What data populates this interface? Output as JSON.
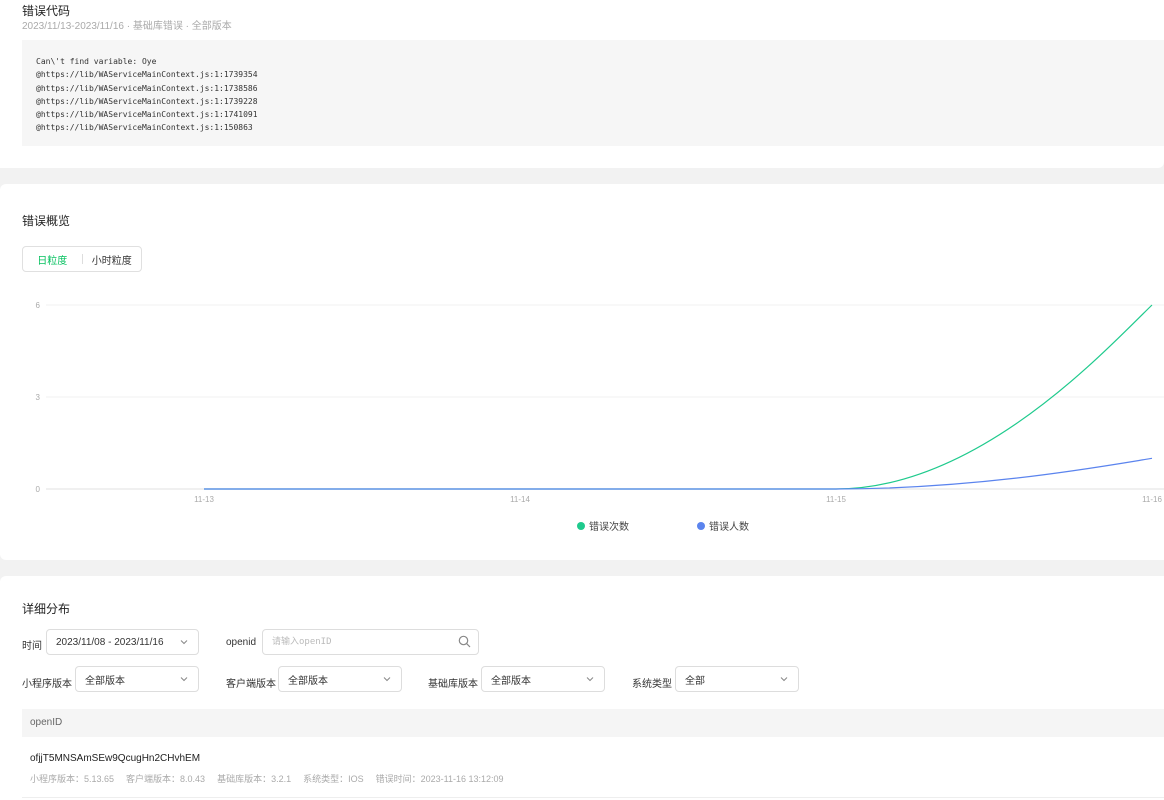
{
  "error_code": {
    "title": "错误代码",
    "subline": "2023/11/13-2023/11/16 · 基础库错误 · 全部版本",
    "code_lines": [
      "Can\\'t find variable: Oye",
      "@https://lib/WAServiceMainContext.js:1:1739354",
      "@https://lib/WAServiceMainContext.js:1:1738586",
      "@https://lib/WAServiceMainContext.js:1:1739228",
      "@https://lib/WAServiceMainContext.js:1:1741091",
      "@https://lib/WAServiceMainContext.js:1:150863"
    ]
  },
  "overview": {
    "title": "错误概览",
    "granularity": {
      "day": "日粒度",
      "hour": "小时粒度",
      "active": "day"
    }
  },
  "chart_data": {
    "type": "line",
    "x": [
      "11-13",
      "11-14",
      "11-15",
      "11-16"
    ],
    "ylim": [
      0,
      6
    ],
    "yticks": [
      0,
      3,
      6
    ],
    "grid": true,
    "legend_position": "bottom",
    "series": [
      {
        "name": "错误次数",
        "color": "#1fca8d",
        "values": [
          0,
          0,
          0,
          6
        ]
      },
      {
        "name": "错误人数",
        "color": "#5b84ee",
        "values": [
          0,
          0,
          0,
          1
        ]
      }
    ]
  },
  "detail": {
    "title": "详细分布",
    "time_label": "时间",
    "time_value": "2023/11/08 - 2023/11/16",
    "openid_label": "openid",
    "openid_placeholder": "请输入openID",
    "mini_version_label": "小程序版本",
    "mini_version_value": "全部版本",
    "client_version_label": "客户端版本",
    "client_version_value": "全部版本",
    "lib_version_label": "基础库版本",
    "lib_version_value": "全部版本",
    "system_label": "系统类型",
    "system_value": "全部",
    "table_header": "openID",
    "rows": [
      {
        "openid": "ofjjT5MNSAmSEw9QcugHn2CHvhEM",
        "mini_version": "小程序版本：5.13.65",
        "client_version": "客户端版本：8.0.43",
        "lib_version": "基础库版本：3.2.1",
        "system": "系统类型：IOS",
        "error_time": "错误时间：2023-11-16 13:12:09"
      }
    ]
  }
}
